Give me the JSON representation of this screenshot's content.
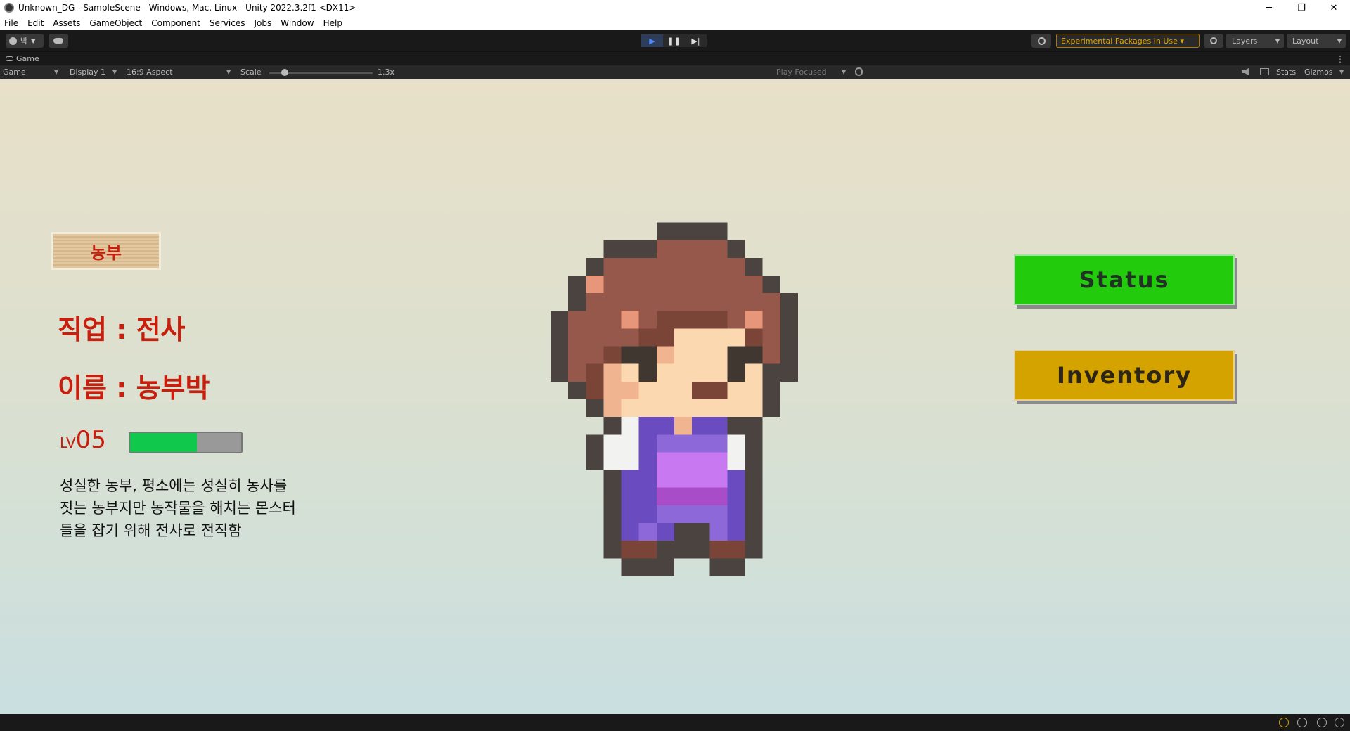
{
  "window": {
    "title": "Unknown_DG - SampleScene - Windows, Mac, Linux - Unity 2022.3.2f1 <DX11>",
    "controls": [
      "─",
      "❐",
      "✕"
    ]
  },
  "menu": [
    "File",
    "Edit",
    "Assets",
    "GameObject",
    "Component",
    "Services",
    "Jobs",
    "Window",
    "Help"
  ],
  "toolbar": {
    "account_label": "박",
    "play_icon": "▶",
    "pause_icon": "❚❚",
    "step_icon": "▶|",
    "experimental_packages": "Experimental Packages In Use ▾",
    "layers": "Layers",
    "layout": "Layout"
  },
  "tab": {
    "label": "Game"
  },
  "gamebar": {
    "mode": "Game",
    "display": "Display 1",
    "aspect": "16:9 Aspect",
    "scale_label": "Scale",
    "scale_value": "1.3x",
    "play_focused": "Play Focused",
    "stats": "Stats",
    "gizmos": "Gizmos"
  },
  "game": {
    "job_badge": "농부",
    "job_line": "직업 :   전사",
    "name_line": "이름 :  농부박",
    "level_prefix": "LV",
    "level_value": "05",
    "exp_fraction": 0.6,
    "description": "성실한 농부, 평소에는 성실히 농사를\n짓는 농부지만 농작물을 해치는 몬스터\n들을 잡기 위해 전사로 전직함",
    "status_button": "Status",
    "inventory_button": "Inventory"
  },
  "colors": {
    "accent_red": "#c81e0e",
    "status_green": "#22cc0c",
    "inventory_gold": "#d4a300",
    "exp_green": "#10c94c"
  }
}
